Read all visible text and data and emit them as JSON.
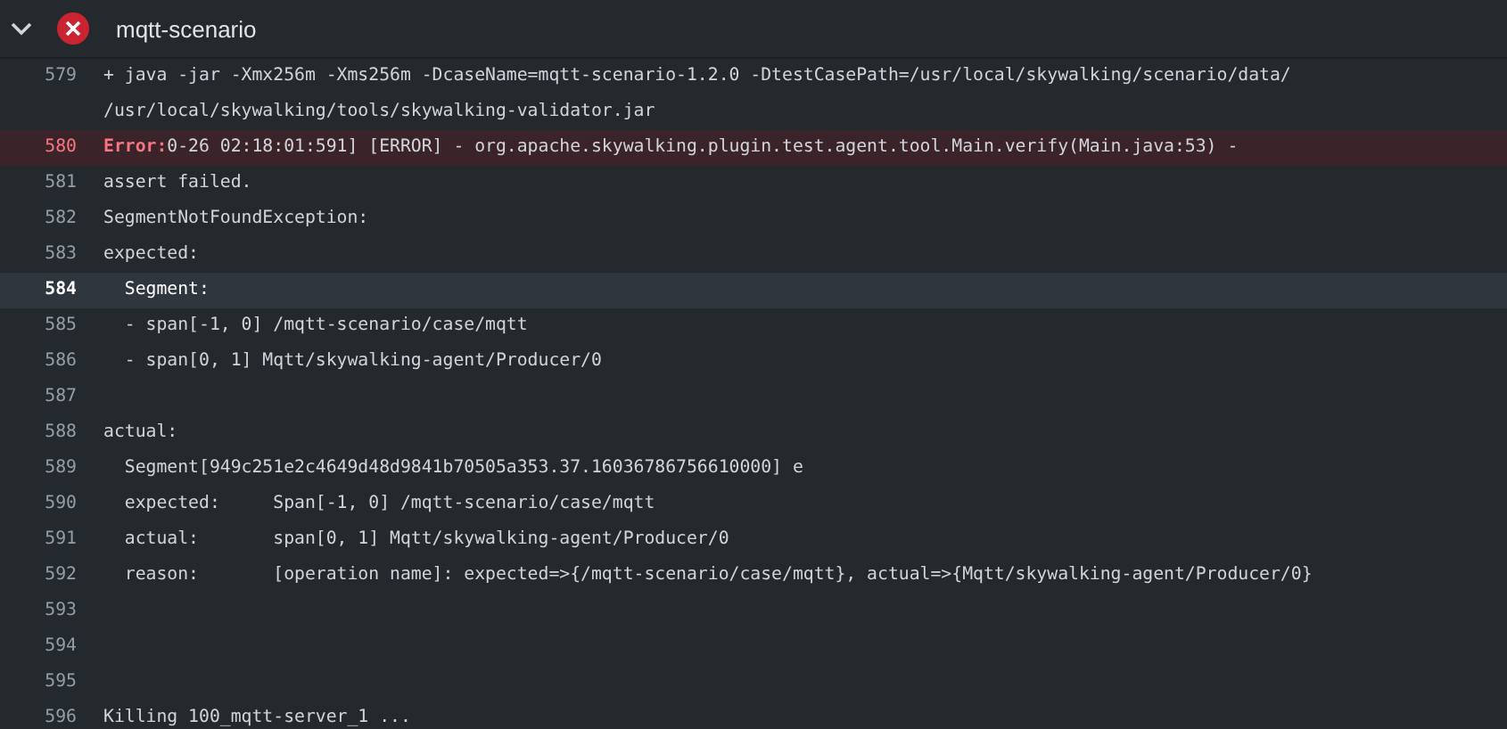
{
  "step": {
    "title": "mqtt-scenario",
    "expanded": true,
    "failed": true
  },
  "log": [
    {
      "number": "579",
      "kind": "normal",
      "selected": false,
      "text": "+ java -jar -Xmx256m -Xms256m -DcaseName=mqtt-scenario-1.2.0 -DtestCasePath=/usr/local/skywalking/scenario/data/",
      "wrapped": "/usr/local/skywalking/tools/skywalking-validator.jar"
    },
    {
      "number": "580",
      "kind": "error",
      "selected": false,
      "label": "Error:",
      "text": "0-26 02:18:01:591] [ERROR] - org.apache.skywalking.plugin.test.agent.tool.Main.verify(Main.java:53) -"
    },
    {
      "number": "581",
      "kind": "normal",
      "selected": false,
      "text": "assert failed."
    },
    {
      "number": "582",
      "kind": "normal",
      "selected": false,
      "text": "SegmentNotFoundException:"
    },
    {
      "number": "583",
      "kind": "normal",
      "selected": false,
      "text": "expected:"
    },
    {
      "number": "584",
      "kind": "normal",
      "selected": true,
      "text": "  Segment:"
    },
    {
      "number": "585",
      "kind": "normal",
      "selected": false,
      "text": "  - span[-1, 0] /mqtt-scenario/case/mqtt"
    },
    {
      "number": "586",
      "kind": "normal",
      "selected": false,
      "text": "  - span[0, 1] Mqtt/skywalking-agent/Producer/0"
    },
    {
      "number": "587",
      "kind": "normal",
      "selected": false
    },
    {
      "number": "588",
      "kind": "normal",
      "selected": false,
      "text": "actual:"
    },
    {
      "number": "589",
      "kind": "normal",
      "selected": false,
      "text": "  Segment[949c251e2c4649d48d9841b70505a353.37.16036786756610000] e"
    },
    {
      "number": "590",
      "kind": "normal",
      "selected": false,
      "text": "  expected:     Span[-1, 0] /mqtt-scenario/case/mqtt"
    },
    {
      "number": "591",
      "kind": "normal",
      "selected": false,
      "text": "  actual:       span[0, 1] Mqtt/skywalking-agent/Producer/0"
    },
    {
      "number": "592",
      "kind": "normal",
      "selected": false,
      "text": "  reason:       [operation name]: expected=>{/mqtt-scenario/case/mqtt}, actual=>{Mqtt/skywalking-agent/Producer/0}"
    },
    {
      "number": "593",
      "kind": "normal",
      "selected": false
    },
    {
      "number": "594",
      "kind": "normal",
      "selected": false
    },
    {
      "number": "595",
      "kind": "normal",
      "selected": false
    },
    {
      "number": "596",
      "kind": "normal",
      "selected": false,
      "text": "Killing 100_mqtt-server_1 ..."
    }
  ]
}
